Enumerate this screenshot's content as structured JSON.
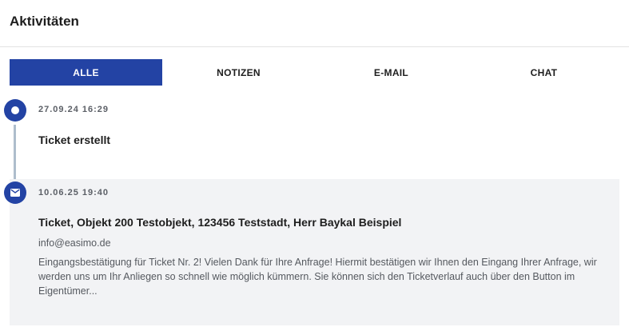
{
  "header": {
    "title": "Aktivitäten"
  },
  "tabs": [
    {
      "label": "ALLE",
      "active": true
    },
    {
      "label": "NOTIZEN",
      "active": false
    },
    {
      "label": "E-MAIL",
      "active": false
    },
    {
      "label": "CHAT",
      "active": false
    }
  ],
  "timeline": [
    {
      "icon": "circle-dot-icon",
      "timestamp": "27.09.24 16:29",
      "title": "Ticket erstellt"
    },
    {
      "icon": "envelope-icon",
      "timestamp": "10.06.25 19:40",
      "title": "Ticket, Objekt 200 Testobjekt, 123456 Teststadt, Herr Baykal Beispiel",
      "sender": "info@easimo.de",
      "body": "Eingangsbestätigung für Ticket Nr. 2! Vielen Dank für Ihre Anfrage! Hiermit bestätigen wir Ihnen den Eingang Ihrer Anfrage, wir werden uns um Ihr Anliegen so schnell wie möglich kümmern. Sie können sich den Ticketverlauf auch über den Button im Eigentümer..."
    }
  ],
  "colors": {
    "accent": "#2343a4",
    "timeline_line": "#aebdcc",
    "highlight_bg": "#f2f3f5"
  }
}
